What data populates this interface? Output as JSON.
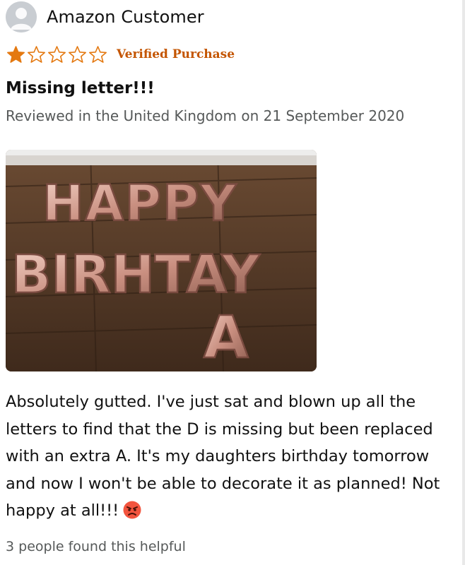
{
  "review": {
    "reviewer_name": "Amazon Customer",
    "rating": {
      "value": 1,
      "max": 5
    },
    "verified_label": "Verified Purchase",
    "title": "Missing letter!!!",
    "meta": "Reviewed in the United Kingdom on 21 September 2020",
    "body": "Absolutely gutted. I've just sat and blown up all the letters to find that the D is missing but been replaced with an extra A. It's my daughters birthday tomorrow and now I won't be able to decorate it as planned! Not happy at all!!!",
    "body_emoji": "angry-face-emoji",
    "helpful": "3 people found this helpful"
  },
  "colors": {
    "star_fill": "#e47911",
    "verified": "#c45500",
    "meta": "#565959",
    "avatar": "#c9cdd2"
  },
  "icons": {
    "avatar": "user-silhouette-icon",
    "star": "star-icon"
  }
}
